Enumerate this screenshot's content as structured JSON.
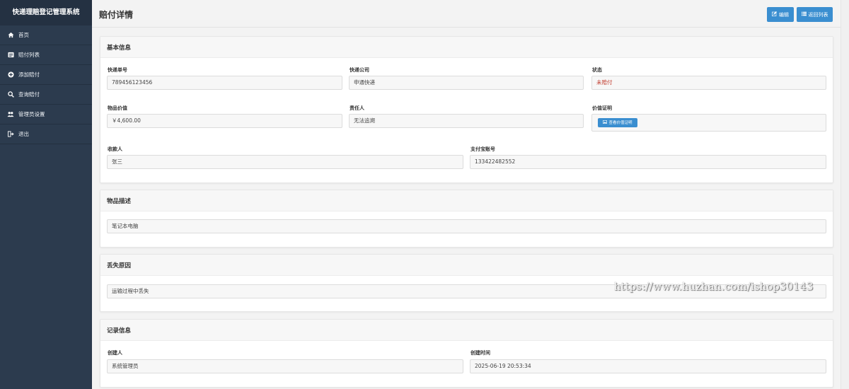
{
  "app": {
    "title": "快递理赔登记管理系统"
  },
  "sidebar": {
    "items": [
      {
        "label": "首页",
        "icon": "home-icon"
      },
      {
        "label": "赔付列表",
        "icon": "list-icon"
      },
      {
        "label": "添加赔付",
        "icon": "plus-circle-icon"
      },
      {
        "label": "查询赔付",
        "icon": "search-icon"
      },
      {
        "label": "管理员设置",
        "icon": "users-icon"
      },
      {
        "label": "退出",
        "icon": "sign-out-icon"
      }
    ]
  },
  "header": {
    "title": "赔付详情",
    "edit_label": "编辑",
    "back_label": "返回列表"
  },
  "basic_info": {
    "title": "基本信息",
    "tracking_no": {
      "label": "快递单号",
      "value": "789456123456"
    },
    "company": {
      "label": "快递公司",
      "value": "申通快递"
    },
    "status": {
      "label": "状态",
      "value": "未赔付"
    },
    "item_value": {
      "label": "物品价值",
      "value": "￥4,600.00"
    },
    "responsible": {
      "label": "责任人",
      "value": "无法追溯"
    },
    "value_proof": {
      "label": "价值证明",
      "button": "查看价值证明"
    },
    "payee": {
      "label": "收款人",
      "value": "张三"
    },
    "alipay": {
      "label": "支付宝账号",
      "value": "133422482552"
    }
  },
  "description": {
    "title": "物品描述",
    "value": "笔记本电脑"
  },
  "loss_reason": {
    "title": "丢失原因",
    "value": "运输过程中丢失"
  },
  "record": {
    "title": "记录信息",
    "creator": {
      "label": "创建人",
      "value": "系统管理员"
    },
    "created_at": {
      "label": "创建时间",
      "value": "2025-06-19 20:53:34"
    }
  },
  "watermark": "https://www.huzhan.com/ishop30143",
  "colors": {
    "sidebar": "#2c3b4e",
    "accent": "#3a8ed0",
    "status": "#c0392b"
  }
}
